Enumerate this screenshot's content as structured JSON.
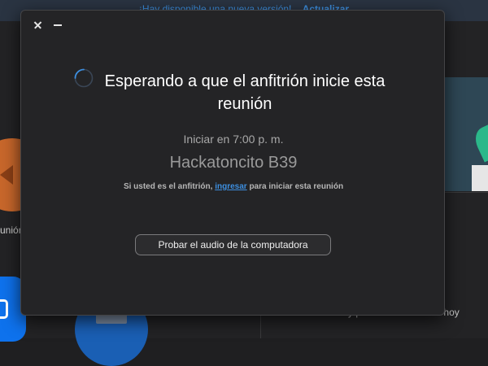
{
  "background": {
    "banner_text": "¡Hay disponible una nueva versión!",
    "banner_link": "Actualizar",
    "left_label": "unión",
    "right_text": "No hay próximas reuniones hoy"
  },
  "dialog": {
    "close_label": "",
    "heading": "Esperando a que el anfitrión inicie esta reunión",
    "start_time": "Iniciar en 7:00 p. m.",
    "meeting_name": "Hackatoncito B39",
    "host_prefix": "Si usted es el anfitrión, ",
    "host_link": "ingresar",
    "host_suffix": " para iniciar esta reunión",
    "test_audio_button": "Probar el audio de la computadora"
  },
  "colors": {
    "accent": "#3d8fe0",
    "dialog_bg": "#242426"
  },
  "icons": [
    "close-icon",
    "minimize-icon",
    "loading-spinner-icon"
  ]
}
